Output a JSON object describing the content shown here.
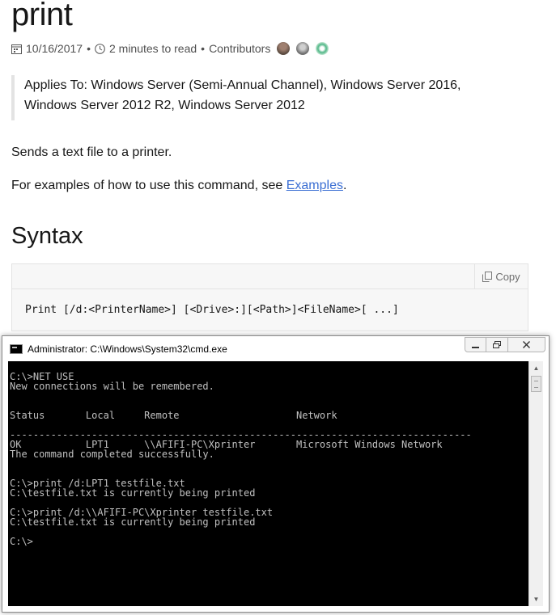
{
  "doc": {
    "title": "print",
    "meta": {
      "date": "10/16/2017",
      "bullet": "•",
      "read_time": "2 minutes to read",
      "contributors": "Contributors"
    },
    "applies_to": "Applies To: Windows Server (Semi-Annual Channel), Windows Server 2016, Windows Server 2012 R2, Windows Server 2012",
    "description": "Sends a text file to a printer.",
    "examples_prefix": "For examples of how to use this command, see ",
    "examples_link": "Examples",
    "examples_suffix": ".",
    "syntax_heading": "Syntax",
    "copy_label": "Copy",
    "syntax_code": "Print [/d:<PrinterName>] [<Drive>:][<Path>]<FileName>[ ...]"
  },
  "cmd_window": {
    "title": "Administrator: C:\\Windows\\System32\\cmd.exe",
    "output": "C:\\>NET USE\nNew connections will be remembered.\n\n\nStatus       Local     Remote                    Network\n\n-------------------------------------------------------------------------------\nOK           LPT1      \\\\AFIFI-PC\\Xprinter       Microsoft Windows Network\nThe command completed successfully.\n\n\nC:\\>print /d:LPT1 testfile.txt\nC:\\testfile.txt is currently being printed\n\nC:\\>print /d:\\\\AFIFI-PC\\Xprinter testfile.txt\nC:\\testfile.txt is currently being printed\n\nC:\\>"
  },
  "colors": {
    "link": "#3a6ed3",
    "console_bg": "#000000",
    "console_text": "#c0c0c0"
  }
}
